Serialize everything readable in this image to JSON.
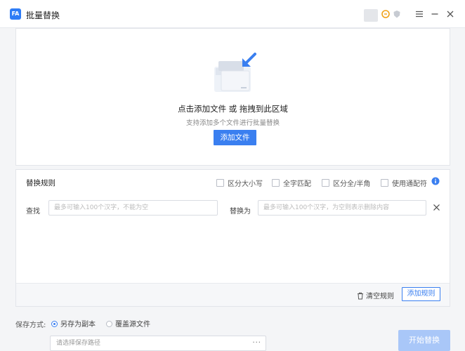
{
  "app": {
    "title": "批量替换"
  },
  "titlebar": {
    "icons": [
      "app-logo-icon",
      "coin-icon",
      "shield-icon",
      "menu-icon",
      "minimize-icon",
      "close-icon"
    ]
  },
  "dropzone": {
    "title": "点击添加文件 或 拖拽到此区域",
    "subtitle": "支持添加多个文件进行批量替换",
    "add_button": "添加文件"
  },
  "rules": {
    "title": "替换规则",
    "options": [
      {
        "label": "区分大小写",
        "checked": false
      },
      {
        "label": "全字匹配",
        "checked": false
      },
      {
        "label": "区分全/半角",
        "checked": false
      },
      {
        "label": "使用通配符",
        "checked": false
      }
    ],
    "find_label": "查找",
    "find_placeholder": "最多可输入100个汉字，不能为空",
    "replace_label": "替换为",
    "replace_placeholder": "最多可输入100个汉字，为空则表示删除内容",
    "clear_label": "清空规则",
    "add_rule_label": "添加规则"
  },
  "save": {
    "label": "保存方式:",
    "options": [
      {
        "label": "另存为副本",
        "selected": true
      },
      {
        "label": "覆盖源文件",
        "selected": false
      }
    ],
    "path_placeholder": "请选择保存路径",
    "path_more": "···"
  },
  "start_button": "开始替换",
  "colors": {
    "accent": "#3a7ff0",
    "start_disabled": "#a9c7f8"
  }
}
